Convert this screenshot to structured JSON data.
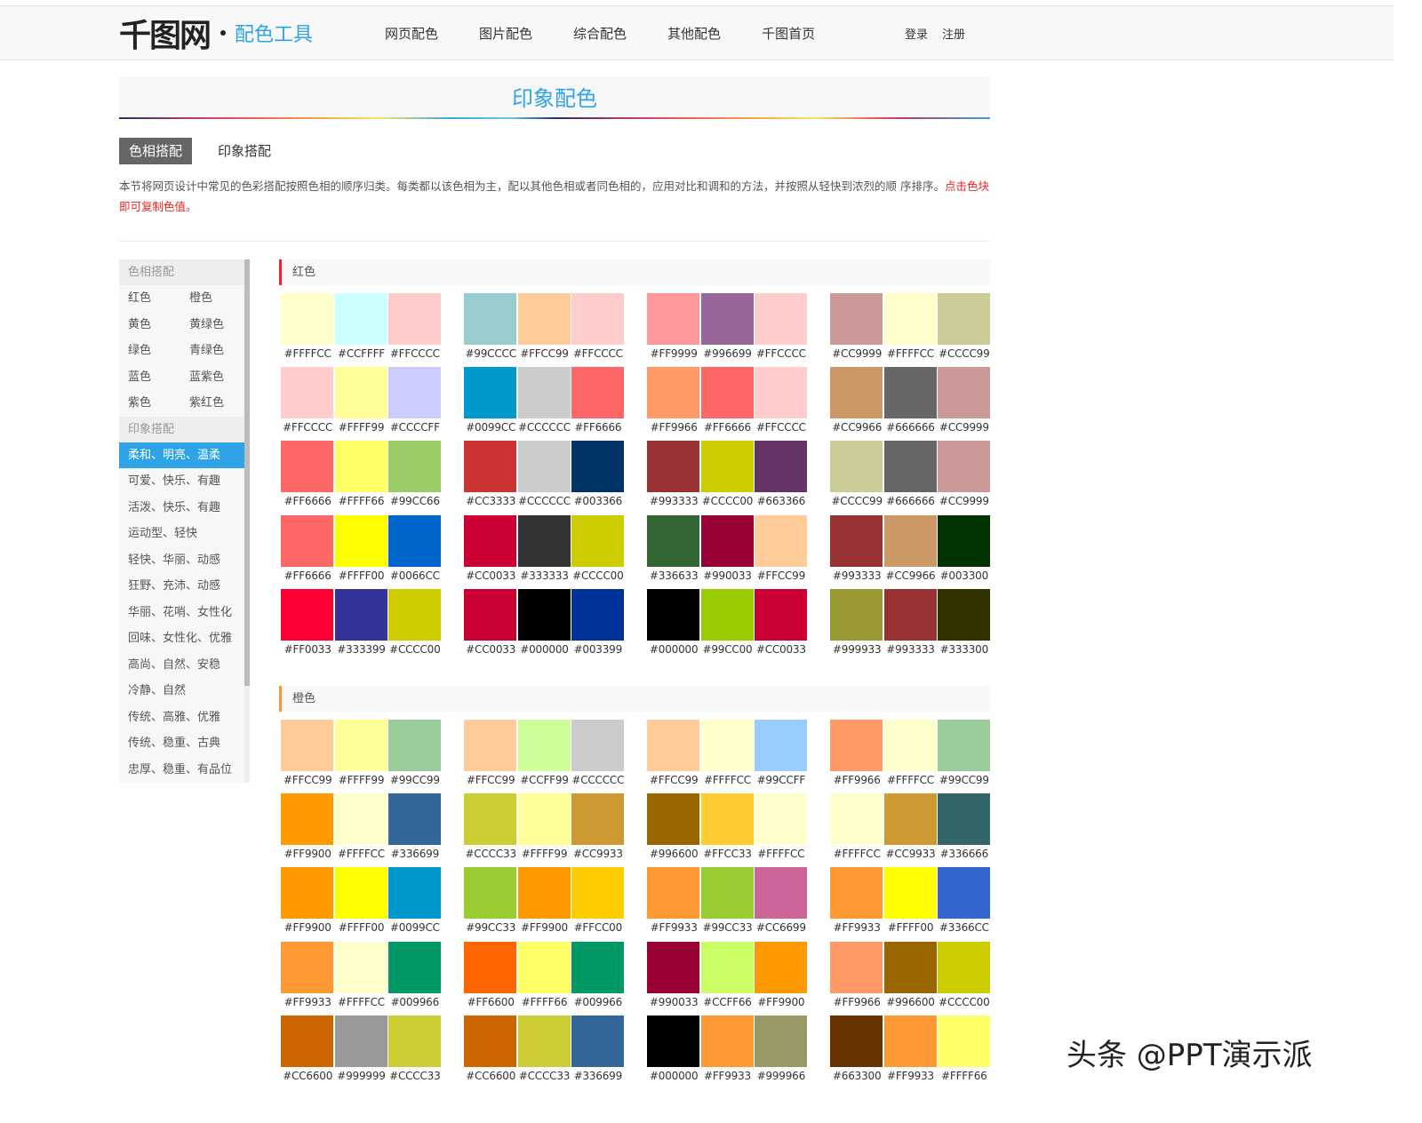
{
  "header": {
    "logo_text": "千图网",
    "tool_name": "配色工具",
    "nav": [
      "网页配色",
      "图片配色",
      "综合配色",
      "其他配色",
      "千图首页"
    ],
    "login": "登录",
    "register": "注册"
  },
  "page": {
    "title": "印象配色",
    "tabs": [
      "色相搭配",
      "印象搭配"
    ],
    "description": "本节将网页设计中常见的色彩搭配按照色相的顺序归类。每类都以该色相为主，配以其他色相或者同色相的，应用对比和调和的方法，并按照从轻快到浓烈的顺 序排序。",
    "hint": "点击色块即可复制色值。"
  },
  "sidebar": {
    "hue_header": "色相搭配",
    "hue_items": [
      "红色",
      "橙色",
      "黄色",
      "黄绿色",
      "绿色",
      "青绿色",
      "蓝色",
      "蓝紫色",
      "紫色",
      "紫红色"
    ],
    "impression_header": "印象搭配",
    "impression_items": [
      "柔和、明亮、温柔",
      "可爱、快乐、有趣",
      "活泼、快乐、有趣",
      "运动型、轻快",
      "轻快、华丽、动感",
      "狂野、充沛、动感",
      "华丽、花哨、女性化",
      "回味、女性化、优雅",
      "高尚、自然、安稳",
      "冷静、自然",
      "传统、高雅、优雅",
      "传统、稳重、古典",
      "忠厚、稳重、有品位"
    ],
    "active_index": 0
  },
  "sections": [
    {
      "title": "红色",
      "palettes": [
        [
          "#FFFFCC",
          "#CCFFFF",
          "#FFCCCC"
        ],
        [
          "#99CCCC",
          "#FFCC99",
          "#FFCCCC"
        ],
        [
          "#FF9999",
          "#996699",
          "#FFCCCC"
        ],
        [
          "#CC9999",
          "#FFFFCC",
          "#CCCC99"
        ],
        [
          "#FFCCCC",
          "#FFFF99",
          "#CCCCFF"
        ],
        [
          "#0099CC",
          "#CCCCCC",
          "#FF6666"
        ],
        [
          "#FF9966",
          "#FF6666",
          "#FFCCCC"
        ],
        [
          "#CC9966",
          "#666666",
          "#CC9999"
        ],
        [
          "#FF6666",
          "#FFFF66",
          "#99CC66"
        ],
        [
          "#CC3333",
          "#CCCCCC",
          "#003366"
        ],
        [
          "#993333",
          "#CCCC00",
          "#663366"
        ],
        [
          "#CCCC99",
          "#666666",
          "#CC9999"
        ],
        [
          "#FF6666",
          "#FFFF00",
          "#0066CC"
        ],
        [
          "#CC0033",
          "#333333",
          "#CCCC00"
        ],
        [
          "#336633",
          "#990033",
          "#FFCC99"
        ],
        [
          "#993333",
          "#CC9966",
          "#003300"
        ],
        [
          "#FF0033",
          "#333399",
          "#CCCC00"
        ],
        [
          "#CC0033",
          "#000000",
          "#003399"
        ],
        [
          "#000000",
          "#99CC00",
          "#CC0033"
        ],
        [
          "#999933",
          "#993333",
          "#333300"
        ]
      ]
    },
    {
      "title": "橙色",
      "palettes": [
        [
          "#FFCC99",
          "#FFFF99",
          "#99CC99"
        ],
        [
          "#FFCC99",
          "#CCFF99",
          "#CCCCCC"
        ],
        [
          "#FFCC99",
          "#FFFFCC",
          "#99CCFF"
        ],
        [
          "#FF9966",
          "#FFFFCC",
          "#99CC99"
        ],
        [
          "#FF9900",
          "#FFFFCC",
          "#336699"
        ],
        [
          "#CCCC33",
          "#FFFF99",
          "#CC9933"
        ],
        [
          "#996600",
          "#FFCC33",
          "#FFFFCC"
        ],
        [
          "#FFFFCC",
          "#CC9933",
          "#336666"
        ],
        [
          "#FF9900",
          "#FFFF00",
          "#0099CC"
        ],
        [
          "#99CC33",
          "#FF9900",
          "#FFCC00"
        ],
        [
          "#FF9933",
          "#99CC33",
          "#CC6699"
        ],
        [
          "#FF9933",
          "#FFFF00",
          "#3366CC"
        ],
        [
          "#FF9933",
          "#FFFFCC",
          "#009966"
        ],
        [
          "#FF6600",
          "#FFFF66",
          "#009966"
        ],
        [
          "#990033",
          "#CCFF66",
          "#FF9900"
        ],
        [
          "#FF9966",
          "#996600",
          "#CCCC00"
        ],
        [
          "#CC6600",
          "#999999",
          "#CCCC33"
        ],
        [
          "#CC6600",
          "#CCCC33",
          "#336699"
        ],
        [
          "#000000",
          "#FF9933",
          "#999966"
        ],
        [
          "#663300",
          "#FF9933",
          "#FFFF66"
        ]
      ]
    }
  ],
  "watermark": "头条 @PPT演示派"
}
